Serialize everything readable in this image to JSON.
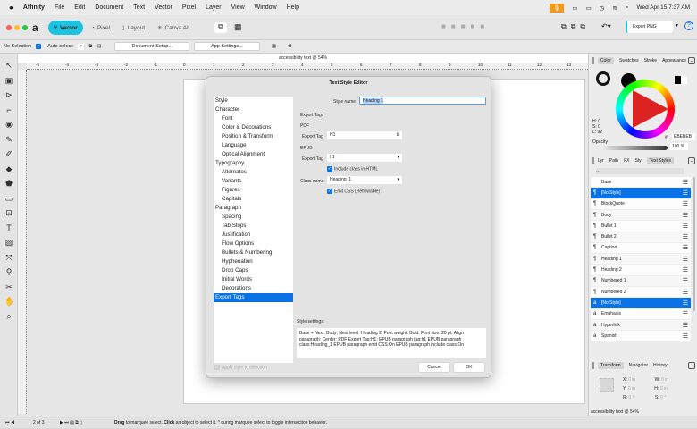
{
  "menubar": {
    "app": "Affinity",
    "items": [
      "File",
      "Edit",
      "Document",
      "Text",
      "Vector",
      "Pixel",
      "Layer",
      "View",
      "Window",
      "Help"
    ],
    "clock": "Wed Apr 15  7:37 AM"
  },
  "toolbar": {
    "personas": [
      "Vector",
      "Pixel",
      "Layout",
      "Canva AI"
    ],
    "export": "Export PNG",
    "accent": "#1cc3e0"
  },
  "context": {
    "selection": "No Selection",
    "autoselect": "Auto-select:",
    "doc_setup": "Document Setup...",
    "app_settings": "App Settings..."
  },
  "document": {
    "title": "accessibility text @ 54%",
    "ruler_ticks": [
      "-5",
      "-4",
      "-3",
      "-2",
      "-1",
      "0",
      "1",
      "2",
      "3",
      "4",
      "5",
      "6",
      "7",
      "8",
      "9",
      "10",
      "11",
      "12",
      "13"
    ]
  },
  "dialog": {
    "title": "Text Style Editor",
    "nav": [
      {
        "label": "Style",
        "sub": false
      },
      {
        "label": "Character",
        "sub": false
      },
      {
        "label": "Font",
        "sub": true
      },
      {
        "label": "Color & Decorations",
        "sub": true
      },
      {
        "label": "Position & Transform",
        "sub": true
      },
      {
        "label": "Language",
        "sub": true
      },
      {
        "label": "Optical Alignment",
        "sub": true
      },
      {
        "label": "Typography",
        "sub": false
      },
      {
        "label": "Alternates",
        "sub": true
      },
      {
        "label": "Variants",
        "sub": true
      },
      {
        "label": "Figures",
        "sub": true
      },
      {
        "label": "Capitals",
        "sub": true
      },
      {
        "label": "Paragraph",
        "sub": false
      },
      {
        "label": "Spacing",
        "sub": true
      },
      {
        "label": "Tab Stops",
        "sub": true
      },
      {
        "label": "Justification",
        "sub": true
      },
      {
        "label": "Flow Options",
        "sub": true
      },
      {
        "label": "Bullets & Numbering",
        "sub": true
      },
      {
        "label": "Hyphenation",
        "sub": true
      },
      {
        "label": "Drop Caps",
        "sub": true
      },
      {
        "label": "Initial Words",
        "sub": true
      },
      {
        "label": "Decorations",
        "sub": true
      },
      {
        "label": "Export Tags",
        "sub": false,
        "selected": true
      }
    ],
    "style_name_label": "Style name",
    "style_name": "Heading 1",
    "export_tags": "Export Tags",
    "pdf": "PDF",
    "export_tag_label": "Export Tag",
    "pdf_tag": "H1",
    "epub": "EPUB",
    "epub_tag": "h1",
    "include_class": "Include class in HTML",
    "class_name_label": "Class name",
    "class_name": "Heading_1",
    "emit_css": "Emit CSS (Reflowable)",
    "settings_label": "Style settings:",
    "settings_text": "Base + Next: Body; Next level: Heading 2; Font weight: Bold; Font size: 20 pt; Align paragraph: Center; PDF Export Tag:H1; EPUB paragraph tag:h1 EPUB paragraph class:Heading_1 EPUB paragraph emit CSS:On EPUB paragraph include class:On",
    "apply": "Apply style to selection",
    "cancel": "Cancel",
    "ok": "OK"
  },
  "right": {
    "color_tabs": [
      "Color",
      "Swatches",
      "Stroke",
      "Appearance"
    ],
    "hsl": [
      "H: 0",
      "S: 0",
      "L: 92"
    ],
    "hex_label": "#:",
    "hex": "EBEBEB",
    "opacity_label": "Opacity",
    "opacity": "100 %",
    "style_tabs": [
      "Lyr",
      "Path",
      "FX",
      "Sty",
      "Text Styles"
    ],
    "styles": [
      {
        "name": "Base",
        "icon": ""
      },
      {
        "name": "[No Style]",
        "icon": "¶",
        "sel": true
      },
      {
        "name": "BlockQuote",
        "icon": "¶"
      },
      {
        "name": "Body",
        "icon": "¶"
      },
      {
        "name": "Bullet 1",
        "icon": "¶"
      },
      {
        "name": "Bullet 2",
        "icon": "¶"
      },
      {
        "name": "Caption",
        "icon": "¶"
      },
      {
        "name": "Heading 1",
        "icon": "¶"
      },
      {
        "name": "Heading 2",
        "icon": "¶"
      },
      {
        "name": "Numbered 1",
        "icon": "¶"
      },
      {
        "name": "Numbered 2",
        "icon": "¶"
      },
      {
        "name": "[No Style]",
        "icon": "a",
        "sel": true
      },
      {
        "name": "Emphasis",
        "icon": "a"
      },
      {
        "name": "Hyperlink",
        "icon": "a"
      },
      {
        "name": "Spanish",
        "icon": "a"
      }
    ],
    "transform_tabs": [
      "Transform",
      "Navigator",
      "History"
    ],
    "transform": {
      "x": "0 in",
      "y": "0 in",
      "w": "0 in",
      "h": "0 in",
      "r": "0 °",
      "s": "0 °"
    },
    "footer": "accessibility text @ 54%"
  },
  "status": {
    "page": "2 of 3",
    "hint_bold1": "Drag",
    "hint1": " to marquee select. ",
    "hint_bold2": "Click",
    "hint2": " an object to select it. ^ during marquee select to toggle intersection behavior."
  }
}
